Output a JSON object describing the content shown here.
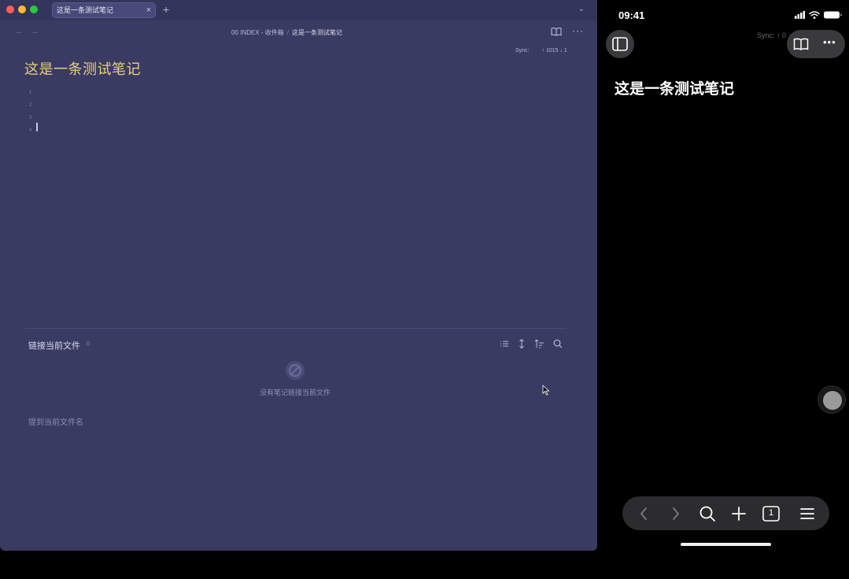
{
  "desktop": {
    "tab": {
      "label": "这是一条测试笔记",
      "close": "×"
    },
    "new_tab": "+",
    "tab_menu": "⌄",
    "nav": {
      "back": "←",
      "forward": "→"
    },
    "breadcrumb": {
      "folder": "00 INDEX - 收件箱",
      "separator": "/",
      "current": "这是一条测试笔记"
    },
    "more": "···",
    "sync": {
      "label": "Sync:",
      "counts": "↑ 1015 ↓ 1"
    },
    "note": {
      "title": "这是一条测试笔记",
      "line_numbers": [
        "1",
        "2",
        "3",
        "4"
      ]
    },
    "backlinks": {
      "title": "链接当前文件",
      "count": "0",
      "empty_text": "没有笔记链接当前文件",
      "mentions_title": "提到当前文件名"
    },
    "icons": [
      "list-icon",
      "expand-icon",
      "sort-icon",
      "search-icon",
      "read-mode-icon",
      "no-links-icon"
    ]
  },
  "phone": {
    "time": "09:41",
    "sync": "Sync: ↑ 0 ↓ 41",
    "title": "这是一条测试笔记",
    "tab_count": "1",
    "more": "•••"
  },
  "colors": {
    "desktop_bg": "#3a3b63",
    "title_accent": "#e7d07c",
    "phone_bg": "#000000"
  }
}
